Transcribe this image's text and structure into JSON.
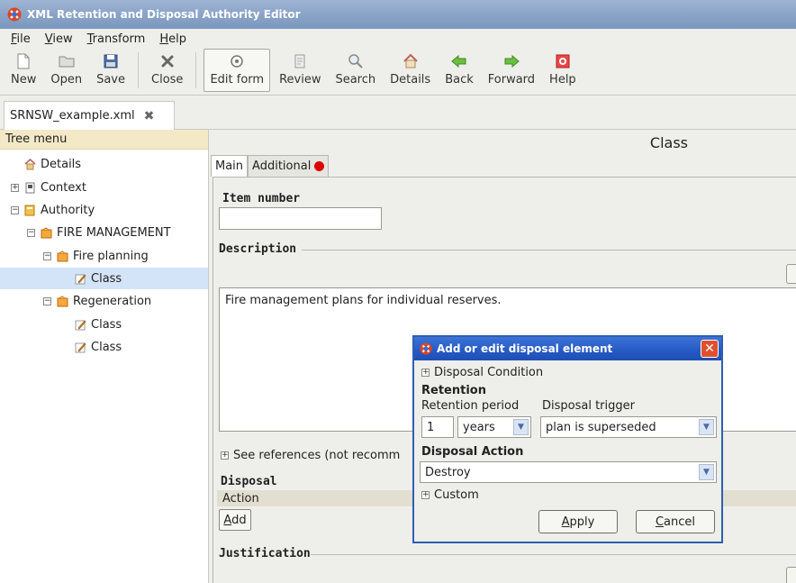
{
  "window": {
    "title": "XML Retention and Disposal Authority Editor"
  },
  "menu": [
    "File",
    "View",
    "Transform",
    "Help"
  ],
  "toolbar": {
    "new": "New",
    "open": "Open",
    "save": "Save",
    "close": "Close",
    "edit_form": "Edit form",
    "review": "Review",
    "search": "Search",
    "details": "Details",
    "back": "Back",
    "forward": "Forward",
    "help": "Help"
  },
  "file_tab": {
    "name": "SRNSW_example.xml"
  },
  "tree": {
    "header": "Tree menu",
    "items": [
      {
        "label": "Details"
      },
      {
        "label": "Context"
      },
      {
        "label": "Authority"
      },
      {
        "label": "FIRE MANAGEMENT"
      },
      {
        "label": "Fire planning"
      },
      {
        "label": "Class"
      },
      {
        "label": "Regeneration"
      },
      {
        "label": "Class"
      },
      {
        "label": "Class"
      }
    ]
  },
  "main": {
    "title": "Class",
    "tabs": [
      "Main",
      "Additional"
    ],
    "item_number_label": "Item number",
    "item_number_value": "",
    "description_label": "Description",
    "description_text": "Fire management plans for individual reserves.",
    "see_references": "See references (not recomm",
    "disposal_label": "Disposal",
    "action_header": "Action",
    "add_button": "Add",
    "justification_label": "Justification"
  },
  "dialog": {
    "title": "Add or edit disposal element",
    "disposal_condition": "Disposal Condition",
    "retention_label": "Retention",
    "retention_period_label": "Retention period",
    "disposal_trigger_label": "Disposal trigger",
    "retention_number": "1",
    "retention_unit": "years",
    "disposal_trigger_value": "plan is superseded",
    "disposal_action_label": "Disposal Action",
    "disposal_action_value": "Destroy",
    "custom": "Custom",
    "apply_button": "Apply",
    "cancel_button": "Cancel"
  },
  "colors": {
    "title_bar": "#8aa4c8",
    "dialog_title": "#2559c4",
    "selection": "#d4e4f8",
    "tree_header": "#f3e9c6"
  }
}
